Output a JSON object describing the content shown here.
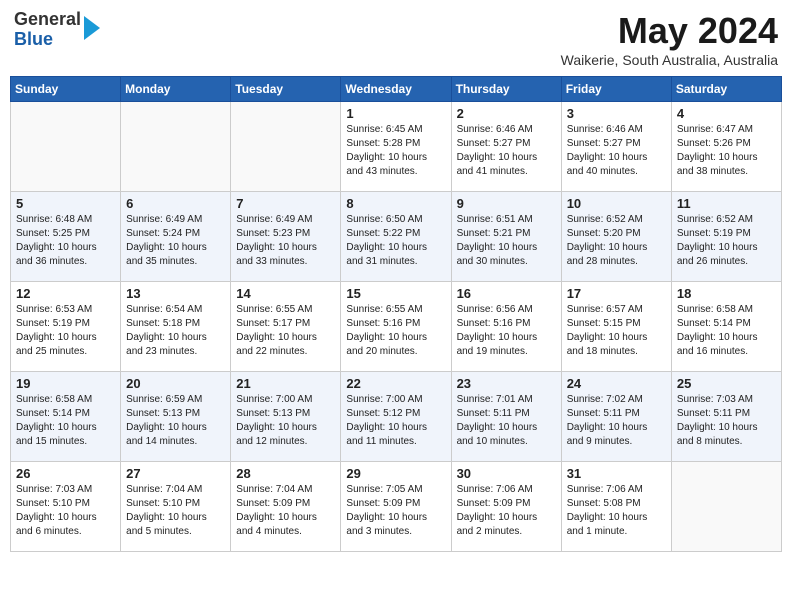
{
  "header": {
    "logo_line1": "General",
    "logo_line2": "Blue",
    "month": "May 2024",
    "location": "Waikerie, South Australia, Australia"
  },
  "weekdays": [
    "Sunday",
    "Monday",
    "Tuesday",
    "Wednesday",
    "Thursday",
    "Friday",
    "Saturday"
  ],
  "weeks": [
    [
      {
        "day": "",
        "info": ""
      },
      {
        "day": "",
        "info": ""
      },
      {
        "day": "",
        "info": ""
      },
      {
        "day": "1",
        "info": "Sunrise: 6:45 AM\nSunset: 5:28 PM\nDaylight: 10 hours\nand 43 minutes."
      },
      {
        "day": "2",
        "info": "Sunrise: 6:46 AM\nSunset: 5:27 PM\nDaylight: 10 hours\nand 41 minutes."
      },
      {
        "day": "3",
        "info": "Sunrise: 6:46 AM\nSunset: 5:27 PM\nDaylight: 10 hours\nand 40 minutes."
      },
      {
        "day": "4",
        "info": "Sunrise: 6:47 AM\nSunset: 5:26 PM\nDaylight: 10 hours\nand 38 minutes."
      }
    ],
    [
      {
        "day": "5",
        "info": "Sunrise: 6:48 AM\nSunset: 5:25 PM\nDaylight: 10 hours\nand 36 minutes."
      },
      {
        "day": "6",
        "info": "Sunrise: 6:49 AM\nSunset: 5:24 PM\nDaylight: 10 hours\nand 35 minutes."
      },
      {
        "day": "7",
        "info": "Sunrise: 6:49 AM\nSunset: 5:23 PM\nDaylight: 10 hours\nand 33 minutes."
      },
      {
        "day": "8",
        "info": "Sunrise: 6:50 AM\nSunset: 5:22 PM\nDaylight: 10 hours\nand 31 minutes."
      },
      {
        "day": "9",
        "info": "Sunrise: 6:51 AM\nSunset: 5:21 PM\nDaylight: 10 hours\nand 30 minutes."
      },
      {
        "day": "10",
        "info": "Sunrise: 6:52 AM\nSunset: 5:20 PM\nDaylight: 10 hours\nand 28 minutes."
      },
      {
        "day": "11",
        "info": "Sunrise: 6:52 AM\nSunset: 5:19 PM\nDaylight: 10 hours\nand 26 minutes."
      }
    ],
    [
      {
        "day": "12",
        "info": "Sunrise: 6:53 AM\nSunset: 5:19 PM\nDaylight: 10 hours\nand 25 minutes."
      },
      {
        "day": "13",
        "info": "Sunrise: 6:54 AM\nSunset: 5:18 PM\nDaylight: 10 hours\nand 23 minutes."
      },
      {
        "day": "14",
        "info": "Sunrise: 6:55 AM\nSunset: 5:17 PM\nDaylight: 10 hours\nand 22 minutes."
      },
      {
        "day": "15",
        "info": "Sunrise: 6:55 AM\nSunset: 5:16 PM\nDaylight: 10 hours\nand 20 minutes."
      },
      {
        "day": "16",
        "info": "Sunrise: 6:56 AM\nSunset: 5:16 PM\nDaylight: 10 hours\nand 19 minutes."
      },
      {
        "day": "17",
        "info": "Sunrise: 6:57 AM\nSunset: 5:15 PM\nDaylight: 10 hours\nand 18 minutes."
      },
      {
        "day": "18",
        "info": "Sunrise: 6:58 AM\nSunset: 5:14 PM\nDaylight: 10 hours\nand 16 minutes."
      }
    ],
    [
      {
        "day": "19",
        "info": "Sunrise: 6:58 AM\nSunset: 5:14 PM\nDaylight: 10 hours\nand 15 minutes."
      },
      {
        "day": "20",
        "info": "Sunrise: 6:59 AM\nSunset: 5:13 PM\nDaylight: 10 hours\nand 14 minutes."
      },
      {
        "day": "21",
        "info": "Sunrise: 7:00 AM\nSunset: 5:13 PM\nDaylight: 10 hours\nand 12 minutes."
      },
      {
        "day": "22",
        "info": "Sunrise: 7:00 AM\nSunset: 5:12 PM\nDaylight: 10 hours\nand 11 minutes."
      },
      {
        "day": "23",
        "info": "Sunrise: 7:01 AM\nSunset: 5:11 PM\nDaylight: 10 hours\nand 10 minutes."
      },
      {
        "day": "24",
        "info": "Sunrise: 7:02 AM\nSunset: 5:11 PM\nDaylight: 10 hours\nand 9 minutes."
      },
      {
        "day": "25",
        "info": "Sunrise: 7:03 AM\nSunset: 5:11 PM\nDaylight: 10 hours\nand 8 minutes."
      }
    ],
    [
      {
        "day": "26",
        "info": "Sunrise: 7:03 AM\nSunset: 5:10 PM\nDaylight: 10 hours\nand 6 minutes."
      },
      {
        "day": "27",
        "info": "Sunrise: 7:04 AM\nSunset: 5:10 PM\nDaylight: 10 hours\nand 5 minutes."
      },
      {
        "day": "28",
        "info": "Sunrise: 7:04 AM\nSunset: 5:09 PM\nDaylight: 10 hours\nand 4 minutes."
      },
      {
        "day": "29",
        "info": "Sunrise: 7:05 AM\nSunset: 5:09 PM\nDaylight: 10 hours\nand 3 minutes."
      },
      {
        "day": "30",
        "info": "Sunrise: 7:06 AM\nSunset: 5:09 PM\nDaylight: 10 hours\nand 2 minutes."
      },
      {
        "day": "31",
        "info": "Sunrise: 7:06 AM\nSunset: 5:08 PM\nDaylight: 10 hours\nand 1 minute."
      },
      {
        "day": "",
        "info": ""
      }
    ]
  ]
}
